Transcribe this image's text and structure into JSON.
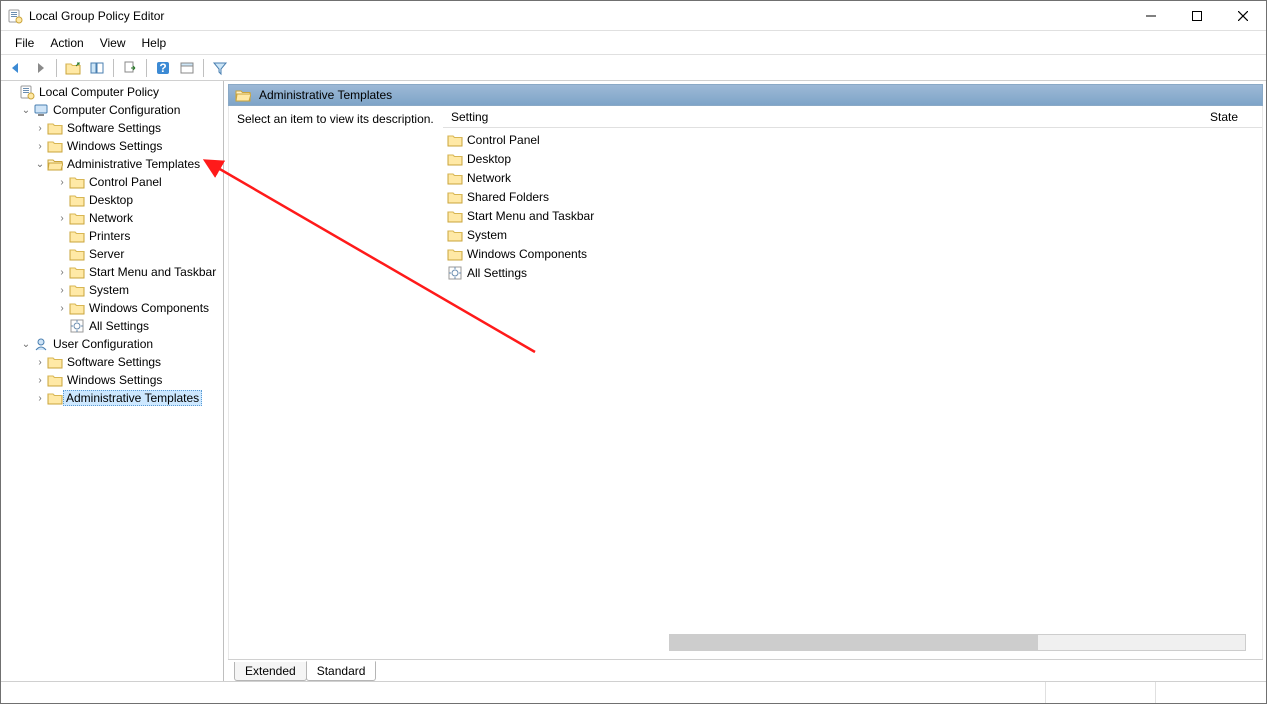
{
  "titlebar": {
    "title": "Local Group Policy Editor"
  },
  "menu": {
    "file": "File",
    "action": "Action",
    "view": "View",
    "help": "Help"
  },
  "tree": {
    "root": "Local Computer Policy",
    "computer": {
      "label": "Computer Configuration",
      "software": "Software Settings",
      "windows": "Windows Settings",
      "admin": {
        "label": "Administrative Templates",
        "children": {
          "controlpanel": "Control Panel",
          "desktop": "Desktop",
          "network": "Network",
          "printers": "Printers",
          "server": "Server",
          "startmenu": "Start Menu and Taskbar",
          "system": "System",
          "wincomp": "Windows Components",
          "allsettings": "All Settings"
        }
      }
    },
    "user": {
      "label": "User Configuration",
      "software": "Software Settings",
      "windows": "Windows Settings",
      "admin": "Administrative Templates"
    }
  },
  "content": {
    "header": "Administrative Templates",
    "description": "Select an item to view its description.",
    "columns": {
      "setting": "Setting",
      "state": "State"
    },
    "items": {
      "controlpanel": "Control Panel",
      "desktop": "Desktop",
      "network": "Network",
      "shared": "Shared Folders",
      "startmenu": "Start Menu and Taskbar",
      "system": "System",
      "wincomp": "Windows Components",
      "allsettings": "All Settings"
    },
    "tabs": {
      "extended": "Extended",
      "standard": "Standard"
    }
  }
}
